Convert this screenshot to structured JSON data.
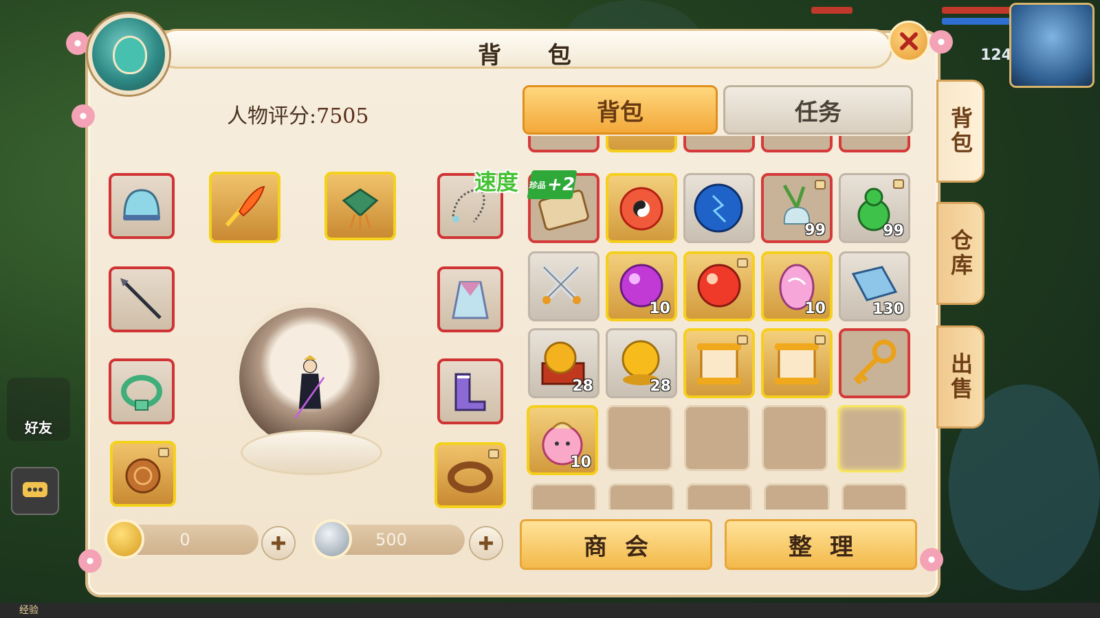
{
  "hud": {
    "player_level": "124",
    "friends_label": "好友",
    "exp_label": "经验"
  },
  "panel": {
    "title": "背 包",
    "score_label": "人物评分:",
    "score_value": "7505"
  },
  "tabs": [
    {
      "label": "背包",
      "active": true
    },
    {
      "label": "任务",
      "active": false
    }
  ],
  "side_tabs": [
    {
      "label": "背包",
      "active": true
    },
    {
      "label": "仓库",
      "active": false
    },
    {
      "label": "出售",
      "active": false
    }
  ],
  "equipment": {
    "left": [
      {
        "icon": "helmet-icon",
        "frame": "red"
      },
      {
        "icon": "spear-icon",
        "frame": "red"
      },
      {
        "icon": "jade-belt-icon",
        "frame": "red"
      },
      {
        "icon": "amulet-icon",
        "frame": "gold",
        "locked": true
      }
    ],
    "top_middle": [
      {
        "icon": "flaming-sword-icon",
        "frame": "gold"
      },
      {
        "icon": "jade-charm-icon",
        "frame": "gold"
      }
    ],
    "right": [
      {
        "icon": "bead-necklace-icon",
        "frame": "red"
      },
      {
        "icon": "robe-icon",
        "frame": "red"
      },
      {
        "icon": "boots-icon",
        "frame": "red"
      },
      {
        "icon": "ring-icon",
        "frame": "gold",
        "locked": true
      }
    ]
  },
  "inventory": {
    "speed_badge": "速度",
    "plus_badge": "+2",
    "plus_badge_tag": "珍品",
    "rows": [
      [
        {
          "icon": "scroll-icon",
          "frame": "red",
          "count": ""
        },
        {
          "icon": "taiji-orb-icon",
          "frame": "gold",
          "count": ""
        },
        {
          "icon": "blue-orb-icon",
          "frame": "normal",
          "count": ""
        },
        {
          "icon": "herb-vase-icon",
          "frame": "red",
          "count": "99",
          "locked": true
        },
        {
          "icon": "green-gourd-icon",
          "frame": "normal",
          "count": "99",
          "locked": true
        }
      ],
      [
        {
          "icon": "crossed-swords-icon",
          "frame": "normal",
          "count": ""
        },
        {
          "icon": "purple-orb-icon",
          "frame": "gold",
          "count": "10"
        },
        {
          "icon": "red-orb-icon",
          "frame": "gold",
          "count": "",
          "locked": true
        },
        {
          "icon": "pink-egg-icon",
          "frame": "gold",
          "count": "10"
        },
        {
          "icon": "blue-book-icon",
          "frame": "normal",
          "count": "130"
        }
      ],
      [
        {
          "icon": "treasure-chest-icon",
          "frame": "normal",
          "count": "28"
        },
        {
          "icon": "gold-ball-icon",
          "frame": "normal",
          "count": "28"
        },
        {
          "icon": "gold-scroll-icon",
          "frame": "gold",
          "count": "",
          "locked": true
        },
        {
          "icon": "gold-scroll-icon",
          "frame": "gold",
          "count": "",
          "locked": true
        },
        {
          "icon": "gold-key-icon",
          "frame": "red",
          "count": ""
        }
      ],
      [
        {
          "icon": "pig-bag-icon",
          "frame": "gold",
          "count": "10"
        },
        {
          "icon": "",
          "frame": "empty",
          "count": ""
        },
        {
          "icon": "",
          "frame": "empty",
          "count": ""
        },
        {
          "icon": "",
          "frame": "empty",
          "count": ""
        },
        {
          "icon": "",
          "frame": "selected",
          "count": ""
        }
      ]
    ]
  },
  "currency": {
    "gold_value": "0",
    "silver_value": "500"
  },
  "buttons": {
    "guild": "商会",
    "sort": "整理"
  },
  "colors": {
    "active_tab": "#f3a93a",
    "red_frame": "#d03333",
    "gold_frame": "#f4d21b",
    "panel_bg": "#f2e4cd"
  }
}
